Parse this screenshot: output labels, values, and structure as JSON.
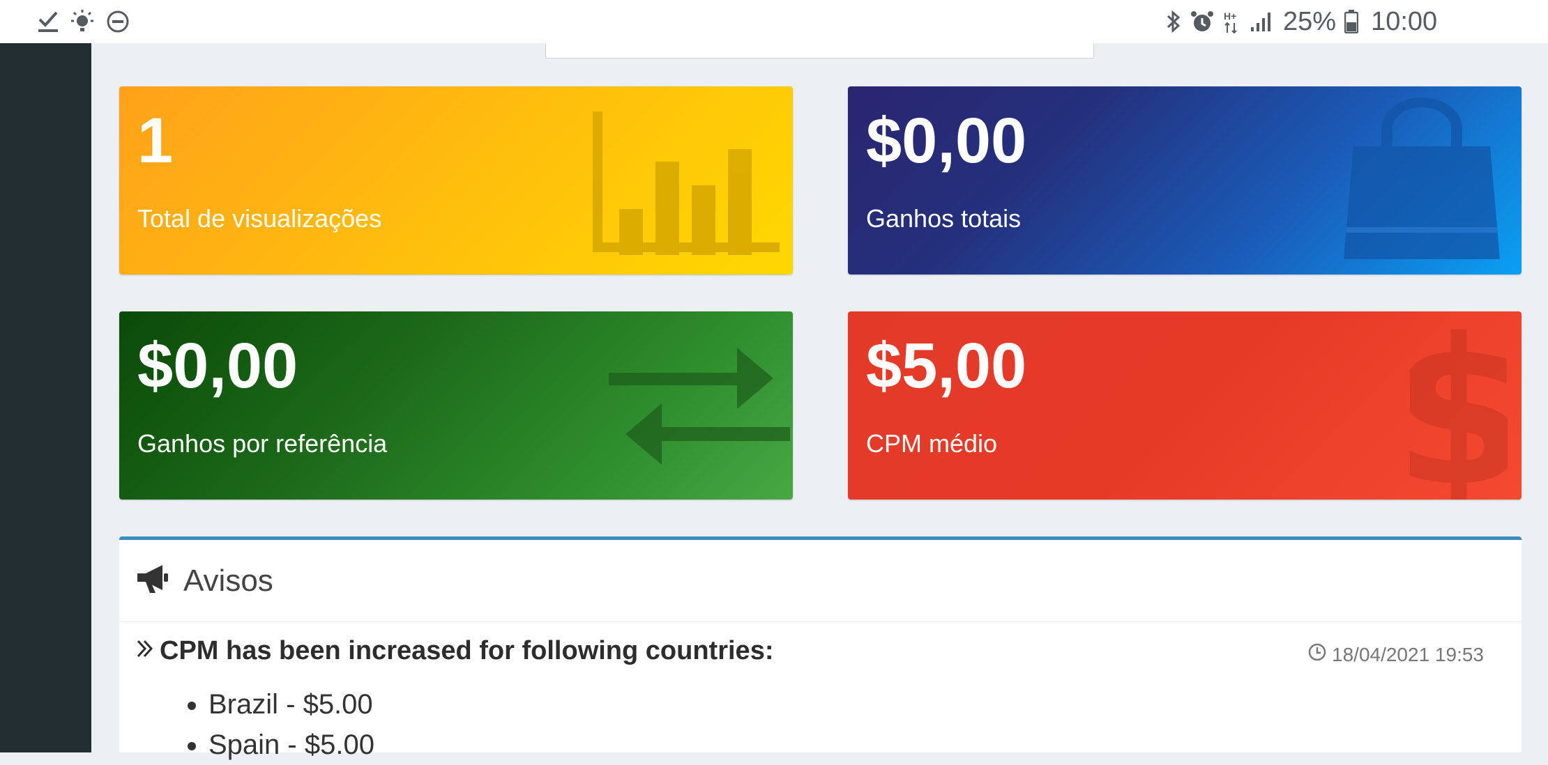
{
  "status_bar": {
    "battery_percent": "25%",
    "time": "10:00",
    "network_label": "H+"
  },
  "stats": [
    {
      "value": "1",
      "label": "Total de visualizações",
      "icon": "bar-chart-icon",
      "color": "#ffb10e"
    },
    {
      "value": "$0,00",
      "label": "Ganhos totais",
      "icon": "shopping-bag-icon",
      "color": "#1d4fa8"
    },
    {
      "value": "$0,00",
      "label": "Ganhos por referência",
      "icon": "exchange-arrows-icon",
      "color": "#1f6f1c"
    },
    {
      "value": "$5,00",
      "label": "CPM médio",
      "icon": "dollar-icon",
      "color": "#e83e2a"
    }
  ],
  "notices": {
    "title": "Avisos",
    "items": [
      {
        "title": "CPM has been increased for following countries:",
        "date": "18/04/2021 19:53",
        "countries": [
          "Brazil - $5.00",
          "Spain - $5.00"
        ]
      }
    ]
  },
  "colors": {
    "sidebar": "#222d32",
    "page_background": "#eceff4",
    "notices_accent": "#3c8dbc"
  }
}
